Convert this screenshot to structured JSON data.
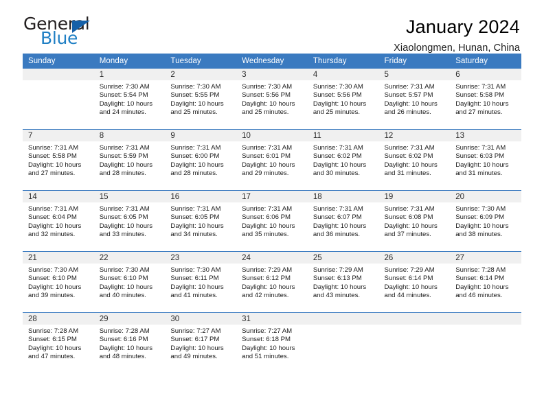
{
  "brand": {
    "name_part1": "General",
    "name_part2": "Blue",
    "triangle_icon": "blue-triangle-icon",
    "colors": {
      "dark": "#231f20",
      "blue": "#1f7fc4",
      "triangle": "#1560a8"
    }
  },
  "header": {
    "title": "January 2024",
    "subtitle": "Xiaolongmen, Hunan, China"
  },
  "theme": {
    "header_blue": "#3a7ac0",
    "daynum_band": "#f0f0f0",
    "text": "#1a1a1a"
  },
  "weekdays": [
    "Sunday",
    "Monday",
    "Tuesday",
    "Wednesday",
    "Thursday",
    "Friday",
    "Saturday"
  ],
  "labels": {
    "sunrise_prefix": "Sunrise:",
    "sunset_prefix": "Sunset:",
    "daylight_prefix": "Daylight:"
  },
  "weeks": [
    [
      {
        "day": "",
        "sunrise": "",
        "sunset": "",
        "daylight_line1": "",
        "daylight_line2": ""
      },
      {
        "day": "1",
        "sunrise": "Sunrise: 7:30 AM",
        "sunset": "Sunset: 5:54 PM",
        "daylight_line1": "Daylight: 10 hours",
        "daylight_line2": "and 24 minutes."
      },
      {
        "day": "2",
        "sunrise": "Sunrise: 7:30 AM",
        "sunset": "Sunset: 5:55 PM",
        "daylight_line1": "Daylight: 10 hours",
        "daylight_line2": "and 25 minutes."
      },
      {
        "day": "3",
        "sunrise": "Sunrise: 7:30 AM",
        "sunset": "Sunset: 5:56 PM",
        "daylight_line1": "Daylight: 10 hours",
        "daylight_line2": "and 25 minutes."
      },
      {
        "day": "4",
        "sunrise": "Sunrise: 7:30 AM",
        "sunset": "Sunset: 5:56 PM",
        "daylight_line1": "Daylight: 10 hours",
        "daylight_line2": "and 25 minutes."
      },
      {
        "day": "5",
        "sunrise": "Sunrise: 7:31 AM",
        "sunset": "Sunset: 5:57 PM",
        "daylight_line1": "Daylight: 10 hours",
        "daylight_line2": "and 26 minutes."
      },
      {
        "day": "6",
        "sunrise": "Sunrise: 7:31 AM",
        "sunset": "Sunset: 5:58 PM",
        "daylight_line1": "Daylight: 10 hours",
        "daylight_line2": "and 27 minutes."
      }
    ],
    [
      {
        "day": "7",
        "sunrise": "Sunrise: 7:31 AM",
        "sunset": "Sunset: 5:58 PM",
        "daylight_line1": "Daylight: 10 hours",
        "daylight_line2": "and 27 minutes."
      },
      {
        "day": "8",
        "sunrise": "Sunrise: 7:31 AM",
        "sunset": "Sunset: 5:59 PM",
        "daylight_line1": "Daylight: 10 hours",
        "daylight_line2": "and 28 minutes."
      },
      {
        "day": "9",
        "sunrise": "Sunrise: 7:31 AM",
        "sunset": "Sunset: 6:00 PM",
        "daylight_line1": "Daylight: 10 hours",
        "daylight_line2": "and 28 minutes."
      },
      {
        "day": "10",
        "sunrise": "Sunrise: 7:31 AM",
        "sunset": "Sunset: 6:01 PM",
        "daylight_line1": "Daylight: 10 hours",
        "daylight_line2": "and 29 minutes."
      },
      {
        "day": "11",
        "sunrise": "Sunrise: 7:31 AM",
        "sunset": "Sunset: 6:02 PM",
        "daylight_line1": "Daylight: 10 hours",
        "daylight_line2": "and 30 minutes."
      },
      {
        "day": "12",
        "sunrise": "Sunrise: 7:31 AM",
        "sunset": "Sunset: 6:02 PM",
        "daylight_line1": "Daylight: 10 hours",
        "daylight_line2": "and 31 minutes."
      },
      {
        "day": "13",
        "sunrise": "Sunrise: 7:31 AM",
        "sunset": "Sunset: 6:03 PM",
        "daylight_line1": "Daylight: 10 hours",
        "daylight_line2": "and 31 minutes."
      }
    ],
    [
      {
        "day": "14",
        "sunrise": "Sunrise: 7:31 AM",
        "sunset": "Sunset: 6:04 PM",
        "daylight_line1": "Daylight: 10 hours",
        "daylight_line2": "and 32 minutes."
      },
      {
        "day": "15",
        "sunrise": "Sunrise: 7:31 AM",
        "sunset": "Sunset: 6:05 PM",
        "daylight_line1": "Daylight: 10 hours",
        "daylight_line2": "and 33 minutes."
      },
      {
        "day": "16",
        "sunrise": "Sunrise: 7:31 AM",
        "sunset": "Sunset: 6:05 PM",
        "daylight_line1": "Daylight: 10 hours",
        "daylight_line2": "and 34 minutes."
      },
      {
        "day": "17",
        "sunrise": "Sunrise: 7:31 AM",
        "sunset": "Sunset: 6:06 PM",
        "daylight_line1": "Daylight: 10 hours",
        "daylight_line2": "and 35 minutes."
      },
      {
        "day": "18",
        "sunrise": "Sunrise: 7:31 AM",
        "sunset": "Sunset: 6:07 PM",
        "daylight_line1": "Daylight: 10 hours",
        "daylight_line2": "and 36 minutes."
      },
      {
        "day": "19",
        "sunrise": "Sunrise: 7:31 AM",
        "sunset": "Sunset: 6:08 PM",
        "daylight_line1": "Daylight: 10 hours",
        "daylight_line2": "and 37 minutes."
      },
      {
        "day": "20",
        "sunrise": "Sunrise: 7:30 AM",
        "sunset": "Sunset: 6:09 PM",
        "daylight_line1": "Daylight: 10 hours",
        "daylight_line2": "and 38 minutes."
      }
    ],
    [
      {
        "day": "21",
        "sunrise": "Sunrise: 7:30 AM",
        "sunset": "Sunset: 6:10 PM",
        "daylight_line1": "Daylight: 10 hours",
        "daylight_line2": "and 39 minutes."
      },
      {
        "day": "22",
        "sunrise": "Sunrise: 7:30 AM",
        "sunset": "Sunset: 6:10 PM",
        "daylight_line1": "Daylight: 10 hours",
        "daylight_line2": "and 40 minutes."
      },
      {
        "day": "23",
        "sunrise": "Sunrise: 7:30 AM",
        "sunset": "Sunset: 6:11 PM",
        "daylight_line1": "Daylight: 10 hours",
        "daylight_line2": "and 41 minutes."
      },
      {
        "day": "24",
        "sunrise": "Sunrise: 7:29 AM",
        "sunset": "Sunset: 6:12 PM",
        "daylight_line1": "Daylight: 10 hours",
        "daylight_line2": "and 42 minutes."
      },
      {
        "day": "25",
        "sunrise": "Sunrise: 7:29 AM",
        "sunset": "Sunset: 6:13 PM",
        "daylight_line1": "Daylight: 10 hours",
        "daylight_line2": "and 43 minutes."
      },
      {
        "day": "26",
        "sunrise": "Sunrise: 7:29 AM",
        "sunset": "Sunset: 6:14 PM",
        "daylight_line1": "Daylight: 10 hours",
        "daylight_line2": "and 44 minutes."
      },
      {
        "day": "27",
        "sunrise": "Sunrise: 7:28 AM",
        "sunset": "Sunset: 6:14 PM",
        "daylight_line1": "Daylight: 10 hours",
        "daylight_line2": "and 46 minutes."
      }
    ],
    [
      {
        "day": "28",
        "sunrise": "Sunrise: 7:28 AM",
        "sunset": "Sunset: 6:15 PM",
        "daylight_line1": "Daylight: 10 hours",
        "daylight_line2": "and 47 minutes."
      },
      {
        "day": "29",
        "sunrise": "Sunrise: 7:28 AM",
        "sunset": "Sunset: 6:16 PM",
        "daylight_line1": "Daylight: 10 hours",
        "daylight_line2": "and 48 minutes."
      },
      {
        "day": "30",
        "sunrise": "Sunrise: 7:27 AM",
        "sunset": "Sunset: 6:17 PM",
        "daylight_line1": "Daylight: 10 hours",
        "daylight_line2": "and 49 minutes."
      },
      {
        "day": "31",
        "sunrise": "Sunrise: 7:27 AM",
        "sunset": "Sunset: 6:18 PM",
        "daylight_line1": "Daylight: 10 hours",
        "daylight_line2": "and 51 minutes."
      },
      {
        "day": "",
        "sunrise": "",
        "sunset": "",
        "daylight_line1": "",
        "daylight_line2": ""
      },
      {
        "day": "",
        "sunrise": "",
        "sunset": "",
        "daylight_line1": "",
        "daylight_line2": ""
      },
      {
        "day": "",
        "sunrise": "",
        "sunset": "",
        "daylight_line1": "",
        "daylight_line2": ""
      }
    ]
  ]
}
